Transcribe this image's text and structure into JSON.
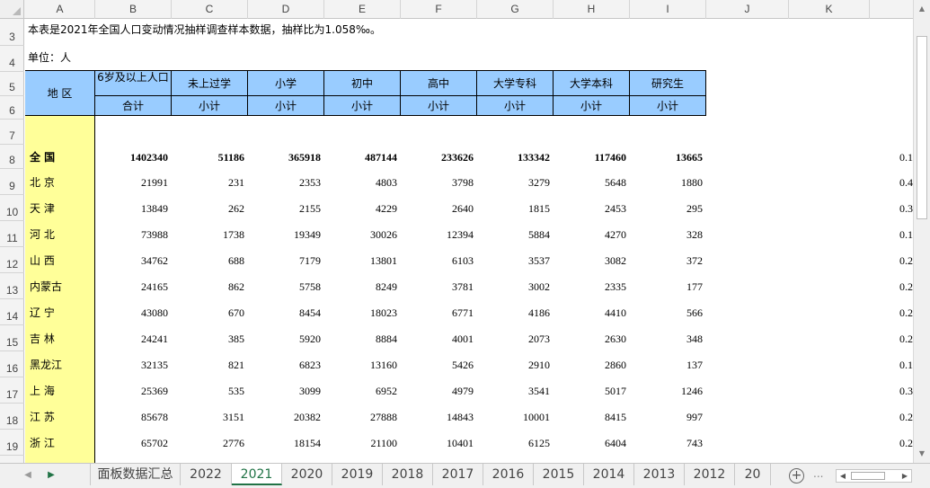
{
  "columns": [
    "A",
    "B",
    "C",
    "D",
    "E",
    "F",
    "G",
    "H",
    "I",
    "J",
    "K"
  ],
  "rows": [
    "3",
    "4",
    "5",
    "6",
    "7",
    "8",
    "9",
    "10",
    "11",
    "12",
    "13",
    "14",
    "15",
    "16",
    "17",
    "18",
    "19"
  ],
  "note": "本表是2021年全国人口变动情况抽样调查样本数据，抽样比为1.058‰。",
  "unit": "单位：人",
  "header": {
    "region": "地 区",
    "top": [
      "6岁及以上人口",
      "未上过学",
      "小学",
      "初中",
      "高中",
      "大学专科",
      "大学本科",
      "研究生"
    ],
    "sub": [
      "合计",
      "小计",
      "小计",
      "小计",
      "小计",
      "小计",
      "小计",
      "小计"
    ]
  },
  "data_rows": [
    {
      "region": "全  国",
      "values": [
        "1402340",
        "51186",
        "365918",
        "487144",
        "233626",
        "133342",
        "117460",
        "13665"
      ],
      "k": "0.1",
      "bold": true
    },
    {
      "region": "北  京",
      "values": [
        "21991",
        "231",
        "2353",
        "4803",
        "3798",
        "3279",
        "5648",
        "1880"
      ],
      "k": "0.4"
    },
    {
      "region": "天  津",
      "values": [
        "13849",
        "262",
        "2155",
        "4229",
        "2640",
        "1815",
        "2453",
        "295"
      ],
      "k": "0.3"
    },
    {
      "region": "河  北",
      "values": [
        "73988",
        "1738",
        "19349",
        "30026",
        "12394",
        "5884",
        "4270",
        "328"
      ],
      "k": "0.1"
    },
    {
      "region": "山  西",
      "values": [
        "34762",
        "688",
        "7179",
        "13801",
        "6103",
        "3537",
        "3082",
        "372"
      ],
      "k": "0.2"
    },
    {
      "region": "内蒙古",
      "values": [
        "24165",
        "862",
        "5758",
        "8249",
        "3781",
        "3002",
        "2335",
        "177"
      ],
      "k": "0.2"
    },
    {
      "region": "辽  宁",
      "values": [
        "43080",
        "670",
        "8454",
        "18023",
        "6771",
        "4186",
        "4410",
        "566"
      ],
      "k": "0.2"
    },
    {
      "region": "吉  林",
      "values": [
        "24241",
        "385",
        "5920",
        "8884",
        "4001",
        "2073",
        "2630",
        "348"
      ],
      "k": "0.2"
    },
    {
      "region": "黑龙江",
      "values": [
        "32135",
        "821",
        "6823",
        "13160",
        "5426",
        "2910",
        "2860",
        "137"
      ],
      "k": "0.1"
    },
    {
      "region": "上  海",
      "values": [
        "25369",
        "535",
        "3099",
        "6952",
        "4979",
        "3541",
        "5017",
        "1246"
      ],
      "k": "0.3"
    },
    {
      "region": "江  苏",
      "values": [
        "85678",
        "3151",
        "20382",
        "27888",
        "14843",
        "10001",
        "8415",
        "997"
      ],
      "k": "0.2"
    },
    {
      "region": "浙  江",
      "values": [
        "65702",
        "2776",
        "18154",
        "21100",
        "10401",
        "6125",
        "6404",
        "743"
      ],
      "k": "0.2"
    }
  ],
  "tabs": [
    "面板数据汇总",
    "2022",
    "2021",
    "2020",
    "2019",
    "2018",
    "2017",
    "2016",
    "2015",
    "2014",
    "2013",
    "2012",
    "20"
  ],
  "active_tab": "2021",
  "add_sheet": "+",
  "dots": "..."
}
